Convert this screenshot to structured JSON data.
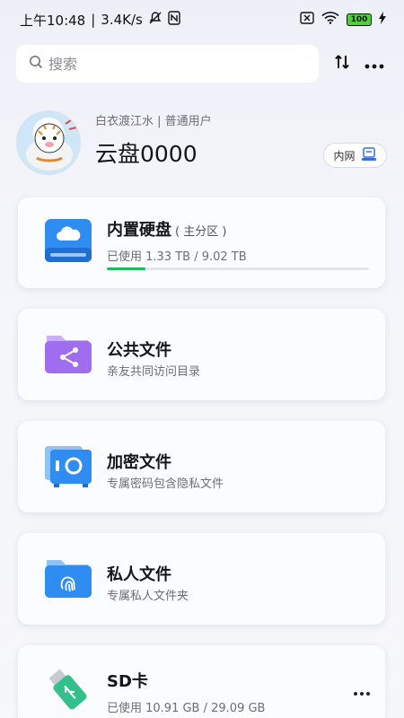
{
  "status_bar": {
    "time": "上午10:48",
    "speed": "3.4K/s",
    "battery": "100"
  },
  "search": {
    "placeholder": "搜索"
  },
  "user": {
    "subtitle": "白衣渡江水 | 普通用户",
    "name": "云盘0000",
    "network_badge": "内网"
  },
  "cards": [
    {
      "title": "内置硬盘",
      "tag": "( 主分区 )",
      "desc": "已使用 1.33 TB / 9.02 TB",
      "usage_fraction": 0.147,
      "icon": "cloud-drive-icon"
    },
    {
      "title": "公共文件",
      "desc": "亲友共同访问目录",
      "icon": "share-folder-icon"
    },
    {
      "title": "加密文件",
      "desc": "专属密码包含隐私文件",
      "icon": "safe-icon"
    },
    {
      "title": "私人文件",
      "desc": "专属私人文件夹",
      "icon": "fingerprint-folder-icon"
    },
    {
      "title": "SD卡",
      "desc": "已使用 10.91 GB / 29.09 GB",
      "icon": "usb-drive-icon"
    }
  ],
  "colors": {
    "accent_blue": "#2f8cf0",
    "progress_green": "#1dbb5d",
    "purple": "#a06cf0"
  }
}
